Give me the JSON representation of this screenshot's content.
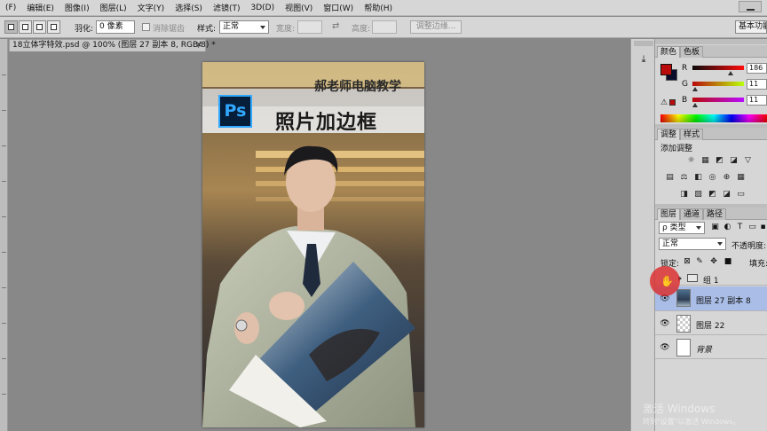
{
  "menubar": {
    "items": [
      "(F)",
      "编辑(E)",
      "图像(I)",
      "图层(L)",
      "文字(Y)",
      "选择(S)",
      "滤镜(T)",
      "3D(D)",
      "视图(V)",
      "窗口(W)",
      "帮助(H)"
    ]
  },
  "options": {
    "feather_label": "羽化:",
    "feather_value": "0 像素",
    "antialias_label": "消除锯齿",
    "style_label": "样式:",
    "style_value": "正常",
    "width_label": "宽度:",
    "height_label": "高度:",
    "refine_edge": "调整边缘...",
    "workspace": "基本功能"
  },
  "document": {
    "tab_title": "18立体字特效.psd @ 100% (图层 27 副本 8, RGB/8) *",
    "close": "×"
  },
  "canvas": {
    "subtitle": "郝老师电脑教学",
    "title": "照片加边框",
    "ps_logo": "Ps"
  },
  "color_panel": {
    "tabs": [
      "颜色",
      "色板"
    ],
    "channels": [
      {
        "label": "R",
        "value": "186",
        "level": 0.73
      },
      {
        "label": "G",
        "value": "11",
        "level": 0.04
      },
      {
        "label": "B",
        "value": "11",
        "level": 0.04
      }
    ],
    "foreground": "#b90b0b",
    "background": "#0b0b2c"
  },
  "adjust_panel": {
    "tabs": [
      "调整",
      "样式"
    ],
    "add_label": "添加调整"
  },
  "layers_panel": {
    "tabs": [
      "图层",
      "通道",
      "路径"
    ],
    "filter_value": "ρ 类型",
    "blend_mode": "正常",
    "opacity_label": "不透明度:",
    "lock_label": "锁定:",
    "fill_label": "填充:",
    "layers": [
      {
        "name": "组 1",
        "type": "group",
        "visible": false
      },
      {
        "name": "图层 27 副本 8",
        "type": "photo",
        "visible": true,
        "selected": true
      },
      {
        "name": "图层 22",
        "type": "checker",
        "visible": true
      },
      {
        "name": "背景",
        "type": "white",
        "visible": true
      }
    ]
  },
  "watermark": {
    "line1": "激活 Windows",
    "line2": "转到\"设置\"以激活 Windows。"
  },
  "icons": {
    "close": "close-icon",
    "eye": "eye-icon",
    "lock": "lock-icon",
    "folder": "folder-icon",
    "history": "history-icon"
  }
}
